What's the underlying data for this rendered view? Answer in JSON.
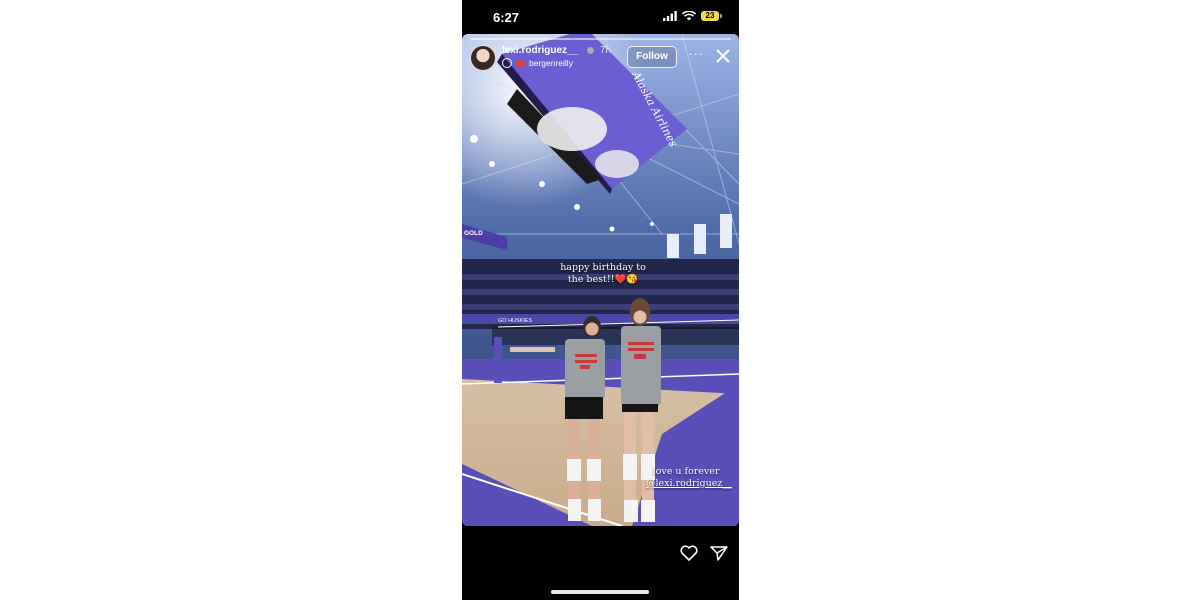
{
  "status": {
    "time": "6:27",
    "battery": "23"
  },
  "story": {
    "username": "lexi.rodriguez__",
    "time_ago": "7h",
    "collab_user": "bergenreilly",
    "follow_label": "Follow",
    "more_label": "···",
    "caption_top": "happy birthday to the best!!",
    "caption_top_emoji": "❤️😘",
    "caption_bottom": "love u forever",
    "mention": "@lexi.rodriguez__",
    "jumbotron_text": "Alaska Airlines",
    "banner_text": "GO HUSKIES",
    "side_sign": "GOLD"
  },
  "colors": {
    "court_purple": "#5a4fb8",
    "accent_yellow": "#f2d84a",
    "background": "#000000"
  }
}
